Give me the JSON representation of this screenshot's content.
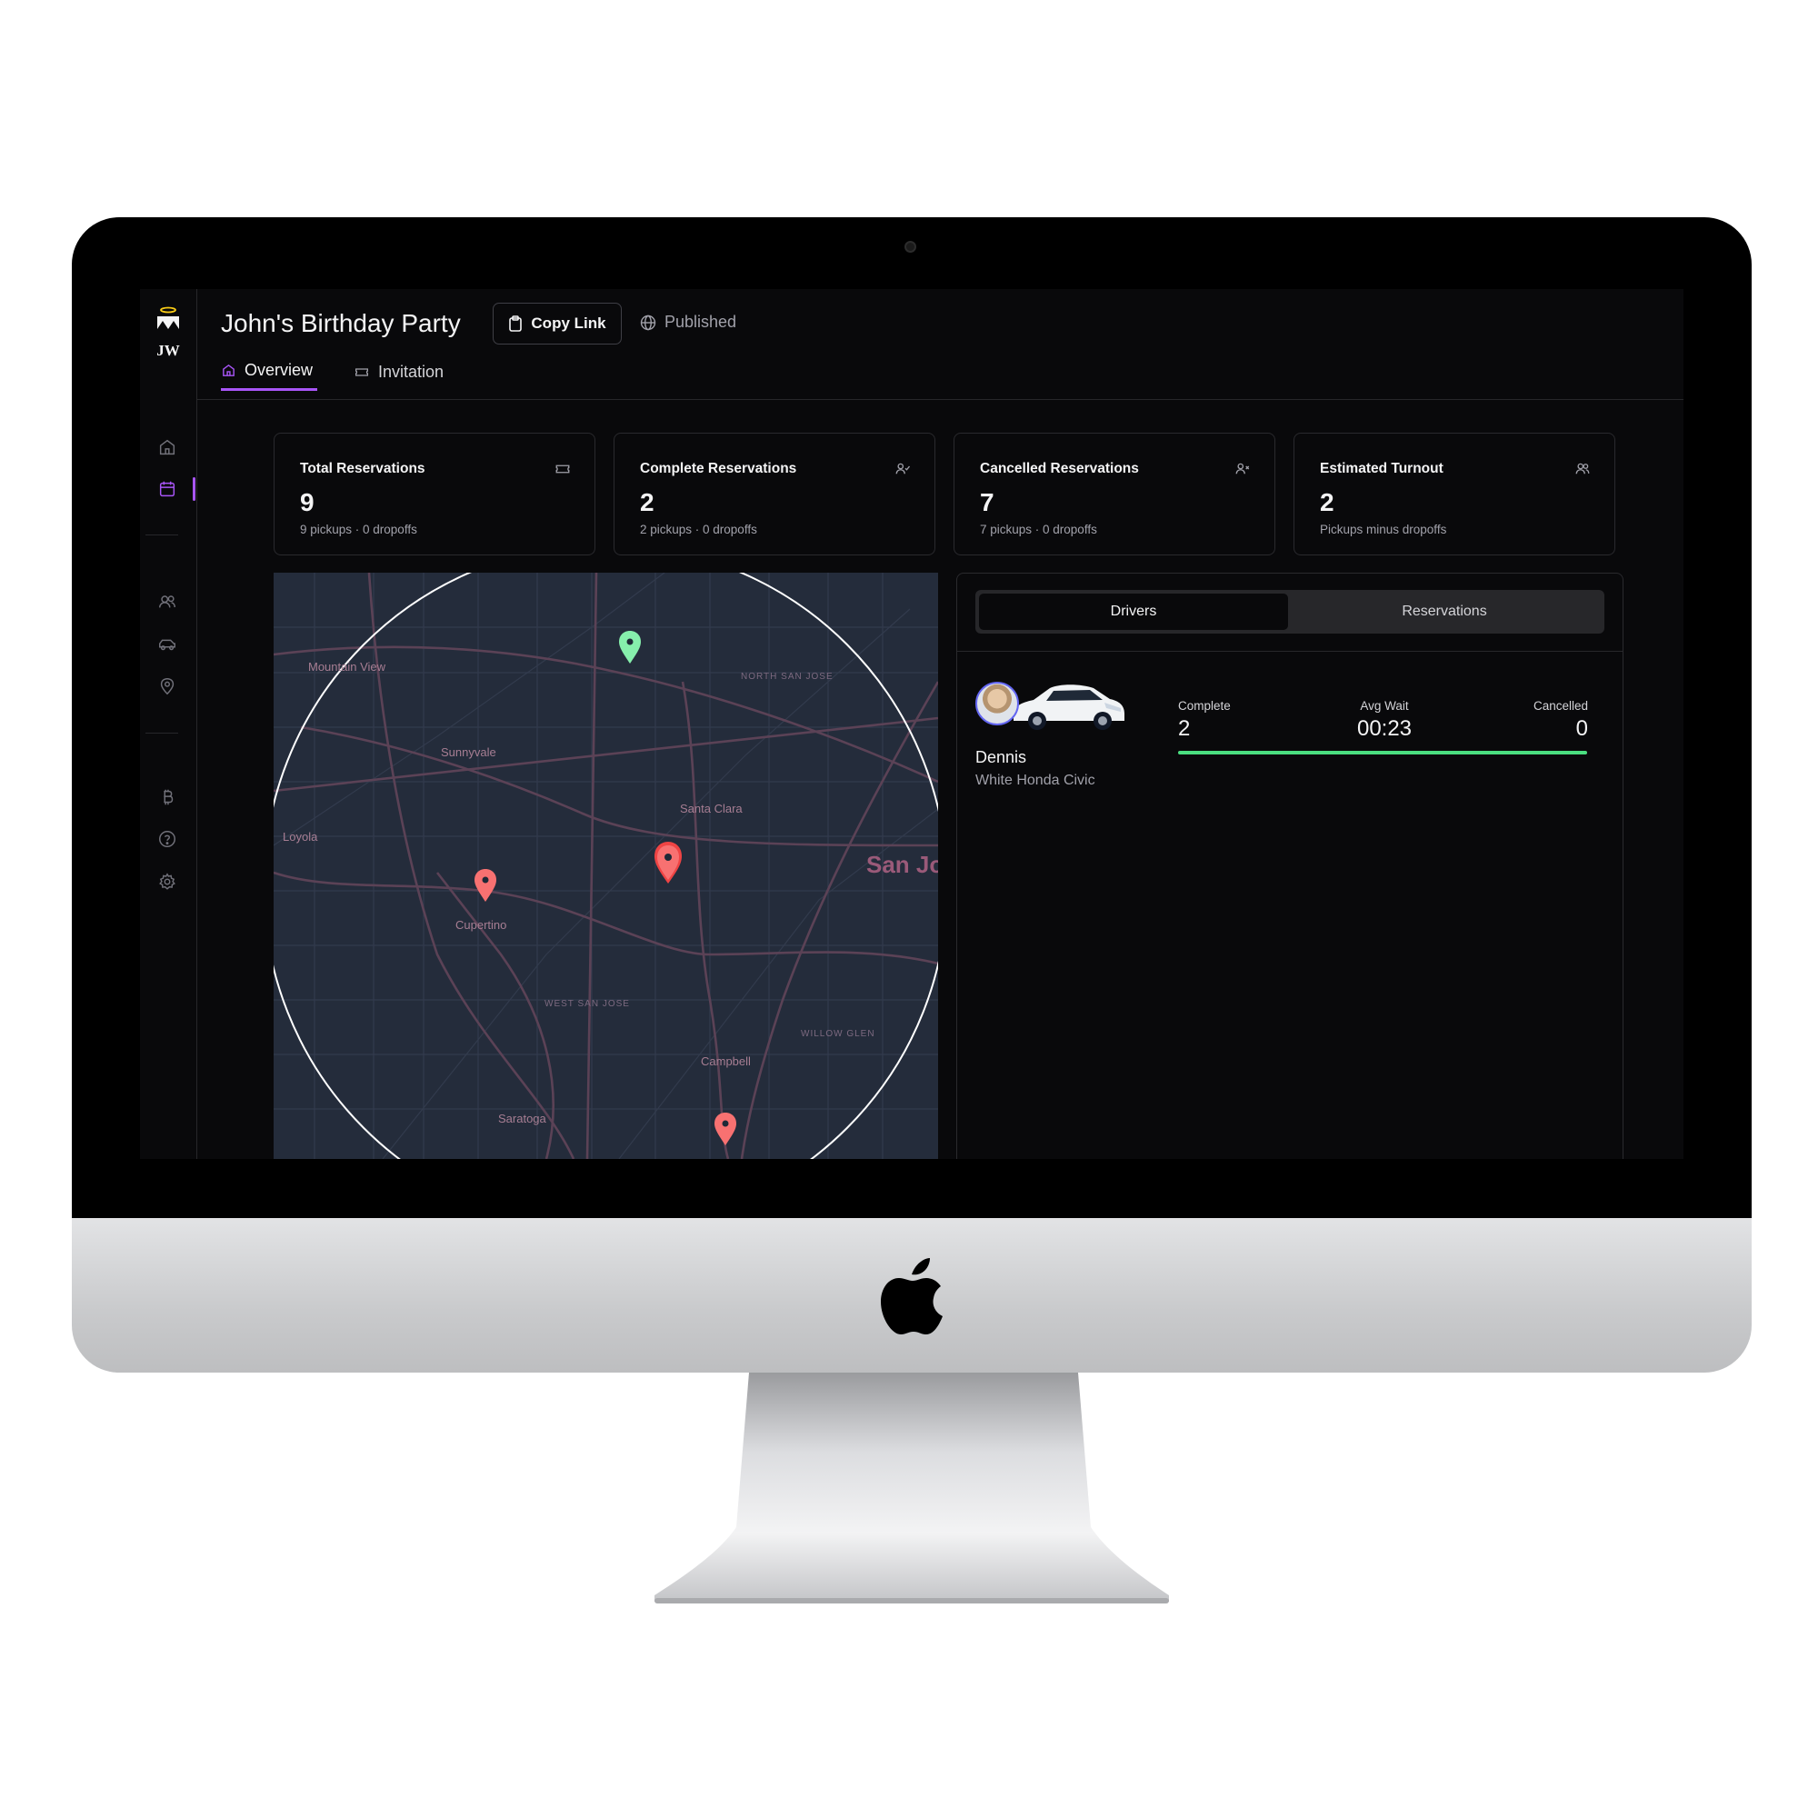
{
  "app": {
    "logo_text": "JW",
    "accent_color": "#a855f7",
    "sidebar_icons": [
      "home-icon",
      "calendar-icon",
      "users-icon",
      "car-icon",
      "map-pin-icon",
      "bitcoin-icon",
      "help-icon",
      "settings-icon"
    ]
  },
  "header": {
    "title": "John's Birthday Party",
    "copy_link_label": "Copy Link",
    "status_label": "Published"
  },
  "tabs": [
    {
      "label": "Overview",
      "active": true,
      "icon": "home-icon"
    },
    {
      "label": "Invitation",
      "active": false,
      "icon": "ticket-icon"
    }
  ],
  "stats": [
    {
      "title": "Total Reservations",
      "value": "9",
      "sub": "9 pickups · 0 dropoffs",
      "icon": "ticket-icon"
    },
    {
      "title": "Complete Reservations",
      "value": "2",
      "sub": "2 pickups · 0 dropoffs",
      "icon": "user-check-icon"
    },
    {
      "title": "Cancelled Reservations",
      "value": "7",
      "sub": "7 pickups · 0 dropoffs",
      "icon": "user-x-icon"
    },
    {
      "title": "Estimated Turnout",
      "value": "2",
      "sub": "Pickups minus dropoffs",
      "icon": "users-icon"
    }
  ],
  "map": {
    "labels": [
      "Mountain View",
      "NORTH SAN JOSE",
      "Sunnyvale",
      "Santa Clara",
      "Loyola",
      "San Jo",
      "Cupertino",
      "WEST SAN JOSE",
      "WILLOW GLEN",
      "Campbell",
      "Saratoga"
    ],
    "marker_colors": {
      "pickup": "#86efac",
      "reservation": "#f87171"
    }
  },
  "panel": {
    "segments": [
      {
        "label": "Drivers",
        "active": true
      },
      {
        "label": "Reservations",
        "active": false
      }
    ],
    "driver": {
      "name": "Dennis",
      "vehicle": "White Honda Civic",
      "complete_label": "Complete",
      "complete_value": "2",
      "avg_wait_label": "Avg Wait",
      "avg_wait_value": "00:23",
      "cancelled_label": "Cancelled",
      "cancelled_value": "0",
      "progress": 1.0
    }
  }
}
